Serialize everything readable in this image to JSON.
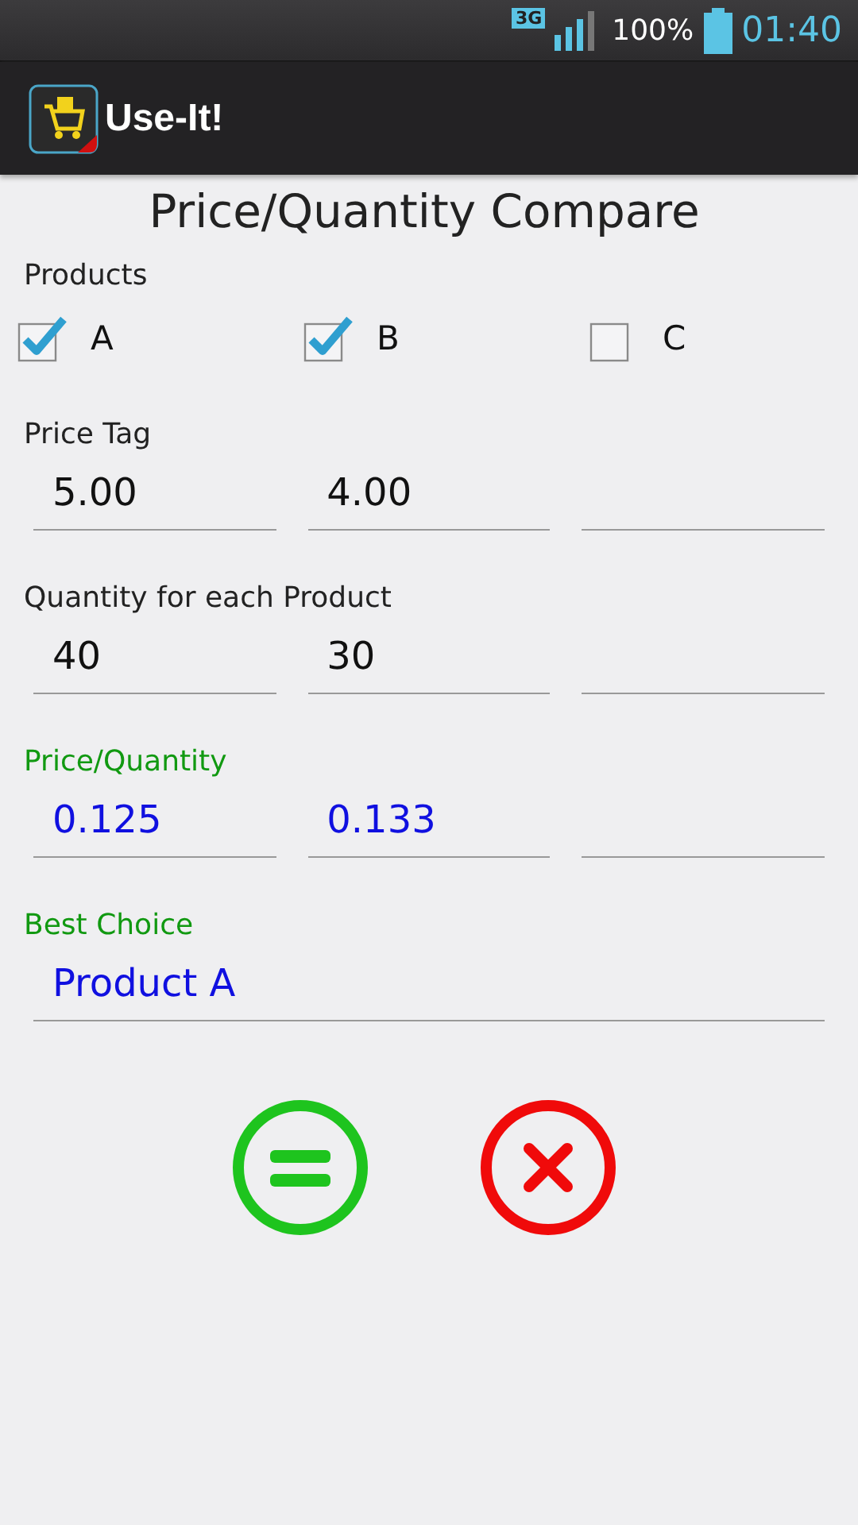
{
  "status_bar": {
    "network": "3G",
    "battery": "100%",
    "time": "01:40"
  },
  "app_bar": {
    "title": "Use-It!"
  },
  "heading": "Price/Quantity Compare",
  "products": {
    "label": "Products",
    "items": [
      {
        "label": "A",
        "checked": true
      },
      {
        "label": "B",
        "checked": true
      },
      {
        "label": "C",
        "checked": false
      }
    ]
  },
  "sections": [
    {
      "label": "Price Tag",
      "kind": "input",
      "fields": [
        {
          "kind": "filled",
          "value": "5.00"
        },
        {
          "kind": "filled",
          "value": "4.00"
        },
        {
          "kind": "blank"
        }
      ]
    },
    {
      "label": "Quantity for each Product",
      "kind": "input",
      "fields": [
        {
          "kind": "filled",
          "value": "40"
        },
        {
          "kind": "filled",
          "value": "30"
        },
        {
          "kind": "blank"
        }
      ]
    },
    {
      "label": "Price/Quantity",
      "kind": "result",
      "fields": [
        {
          "kind": "filled",
          "value": "0.125"
        },
        {
          "kind": "filled",
          "value": "0.133"
        },
        {
          "kind": "blank"
        }
      ]
    },
    {
      "label": "Best Choice",
      "kind": "result",
      "fields": [
        {
          "kind": "filled",
          "value": "Product A"
        }
      ]
    }
  ]
}
